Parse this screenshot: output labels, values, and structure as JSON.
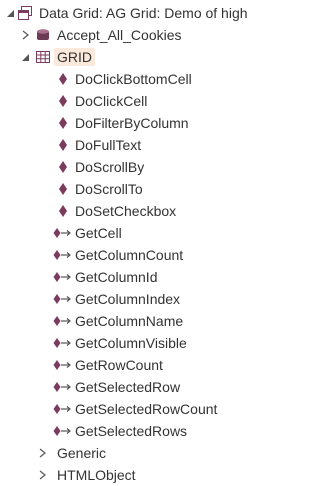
{
  "tree": {
    "root": {
      "label": "Data Grid: AG Grid: Demo of high"
    },
    "accept_cookies": {
      "label": "Accept_All_Cookies"
    },
    "grid": {
      "label": "GRID"
    },
    "actions": [
      {
        "label": "DoClickBottomCell"
      },
      {
        "label": "DoClickCell"
      },
      {
        "label": "DoFilterByColumn"
      },
      {
        "label": "DoFullText"
      },
      {
        "label": "DoScrollBy"
      },
      {
        "label": "DoScrollTo"
      },
      {
        "label": "DoSetCheckbox"
      }
    ],
    "getters": [
      {
        "label": "GetCell"
      },
      {
        "label": "GetColumnCount"
      },
      {
        "label": "GetColumnId"
      },
      {
        "label": "GetColumnIndex"
      },
      {
        "label": "GetColumnName"
      },
      {
        "label": "GetColumnVisible"
      },
      {
        "label": "GetRowCount"
      },
      {
        "label": "GetSelectedRow"
      },
      {
        "label": "GetSelectedRowCount"
      },
      {
        "label": "GetSelectedRows"
      }
    ],
    "generic": {
      "label": "Generic"
    },
    "htmlobject": {
      "label": "HTMLObject"
    }
  },
  "colors": {
    "icon_purple": "#7a3b5e",
    "arrow": "#555555",
    "highlight": "#fbe9dc"
  },
  "icons": {
    "root": "window-icon",
    "accept_cookies": "database-icon",
    "grid": "grid-table-icon",
    "actions": "diamond-method-icon",
    "getters": "diamond-arrow-property-icon"
  }
}
